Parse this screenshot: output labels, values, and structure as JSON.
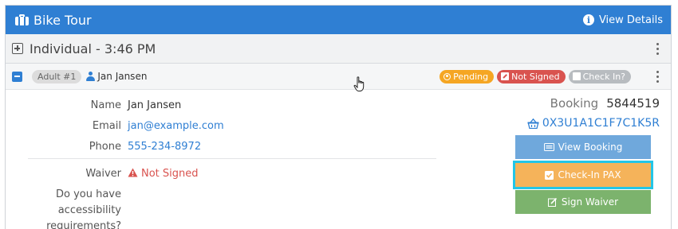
{
  "header": {
    "title": "Bike Tour",
    "view_details": "View Details",
    "bg": "#2f7fd3"
  },
  "group": {
    "label": "Individual - 3:46 PM"
  },
  "participant": {
    "badge": "Adult #1",
    "name": "Jan Jansen",
    "statuses": {
      "pending": "Pending",
      "not_signed": "Not Signed",
      "check_in": "Check In?"
    }
  },
  "details": {
    "name_label": "Name",
    "name_value": "Jan Jansen",
    "email_label": "Email",
    "email_value": "jan@example.com",
    "phone_label": "Phone",
    "phone_value": "555-234-8972",
    "waiver_label": "Waiver",
    "waiver_value": "Not Signed",
    "question_line1": "Do you have",
    "question_line2": "accessibility",
    "question_line3": "requirements?"
  },
  "booking": {
    "label": "Booking",
    "number": "5844519",
    "code": "0X3U1A1C1F7C1K5R"
  },
  "actions": {
    "view_booking": "View Booking",
    "check_in_pax": "Check-In PAX",
    "sign_waiver": "Sign Waiver"
  },
  "colors": {
    "pending": "#f5a623",
    "not_signed": "#d9534f",
    "check_in": "#b8bcc0",
    "view_booking": "#6fa8dc",
    "check_in_pax": "#f5b35a",
    "sign_waiver": "#7cb36d",
    "focus_outline": "#23c6e8"
  }
}
